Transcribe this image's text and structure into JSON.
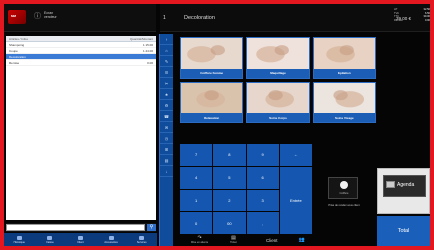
{
  "shop": {
    "logo_text": "MM",
    "name_line1": "Ecran",
    "name_line2": "vendeur"
  },
  "header": {
    "ticket_number": "1",
    "title": "Decoloration",
    "total": "39.00 €"
  },
  "summary": [
    {
      "k": "HT",
      "v": "32.50"
    },
    {
      "k": "TVA",
      "v": "6.50"
    },
    {
      "k": "TTC",
      "v": "39.00"
    },
    {
      "k": "Remise",
      "v": "0.00"
    }
  ],
  "list": {
    "headers": [
      "Articles / Infos",
      "Quantité/Montant"
    ],
    "rows": [
      {
        "name": "Shampoing",
        "qty": "1",
        "amount": "15.00",
        "selected": false
      },
      {
        "name": "Coupe",
        "qty": "1",
        "amount": "24.00",
        "selected": false
      },
      {
        "name": "Decoloration",
        "qty": "",
        "amount": "",
        "selected": true
      },
      {
        "name": "Remise",
        "qty": "",
        "amount": "0.00",
        "selected": false
      }
    ]
  },
  "search": {
    "placeholder": "",
    "button_icon": "search-icon"
  },
  "bottom_bar": [
    "Historique",
    "Caisse",
    "Client",
    "Accessoires",
    "Services"
  ],
  "vnav_icons": [
    "↑",
    "⌂",
    "✎",
    "☰",
    "✂",
    "★",
    "⚙",
    "☎",
    "✉",
    "◷",
    "⊞",
    "▤",
    "↓"
  ],
  "services": [
    {
      "label": "Coiffure Femme",
      "tone": "#e8d9cf"
    },
    {
      "label": "Maquillage",
      "tone": "#efe2dc"
    },
    {
      "label": "Epilation",
      "tone": "#e7d2c4"
    },
    {
      "label": "Relaxation",
      "tone": "#d9c3ad"
    },
    {
      "label": "Soins Corps",
      "tone": "#e6d6cc"
    },
    {
      "label": "Soins Visage",
      "tone": "#ece4de"
    }
  ],
  "keypad": [
    "7",
    "8",
    "9",
    "←",
    "4",
    "5",
    "6",
    "1",
    "2",
    "3",
    "Entrée",
    "0",
    "00",
    ","
  ],
  "actions": {
    "left_label": "Mise en attente",
    "mid_label": "Ticket",
    "client": "Client"
  },
  "promo": {
    "brand": "Coiffure",
    "text": "Prise de rendez-vous client"
  },
  "agenda_label": "Agenda",
  "total_label": "Total"
}
